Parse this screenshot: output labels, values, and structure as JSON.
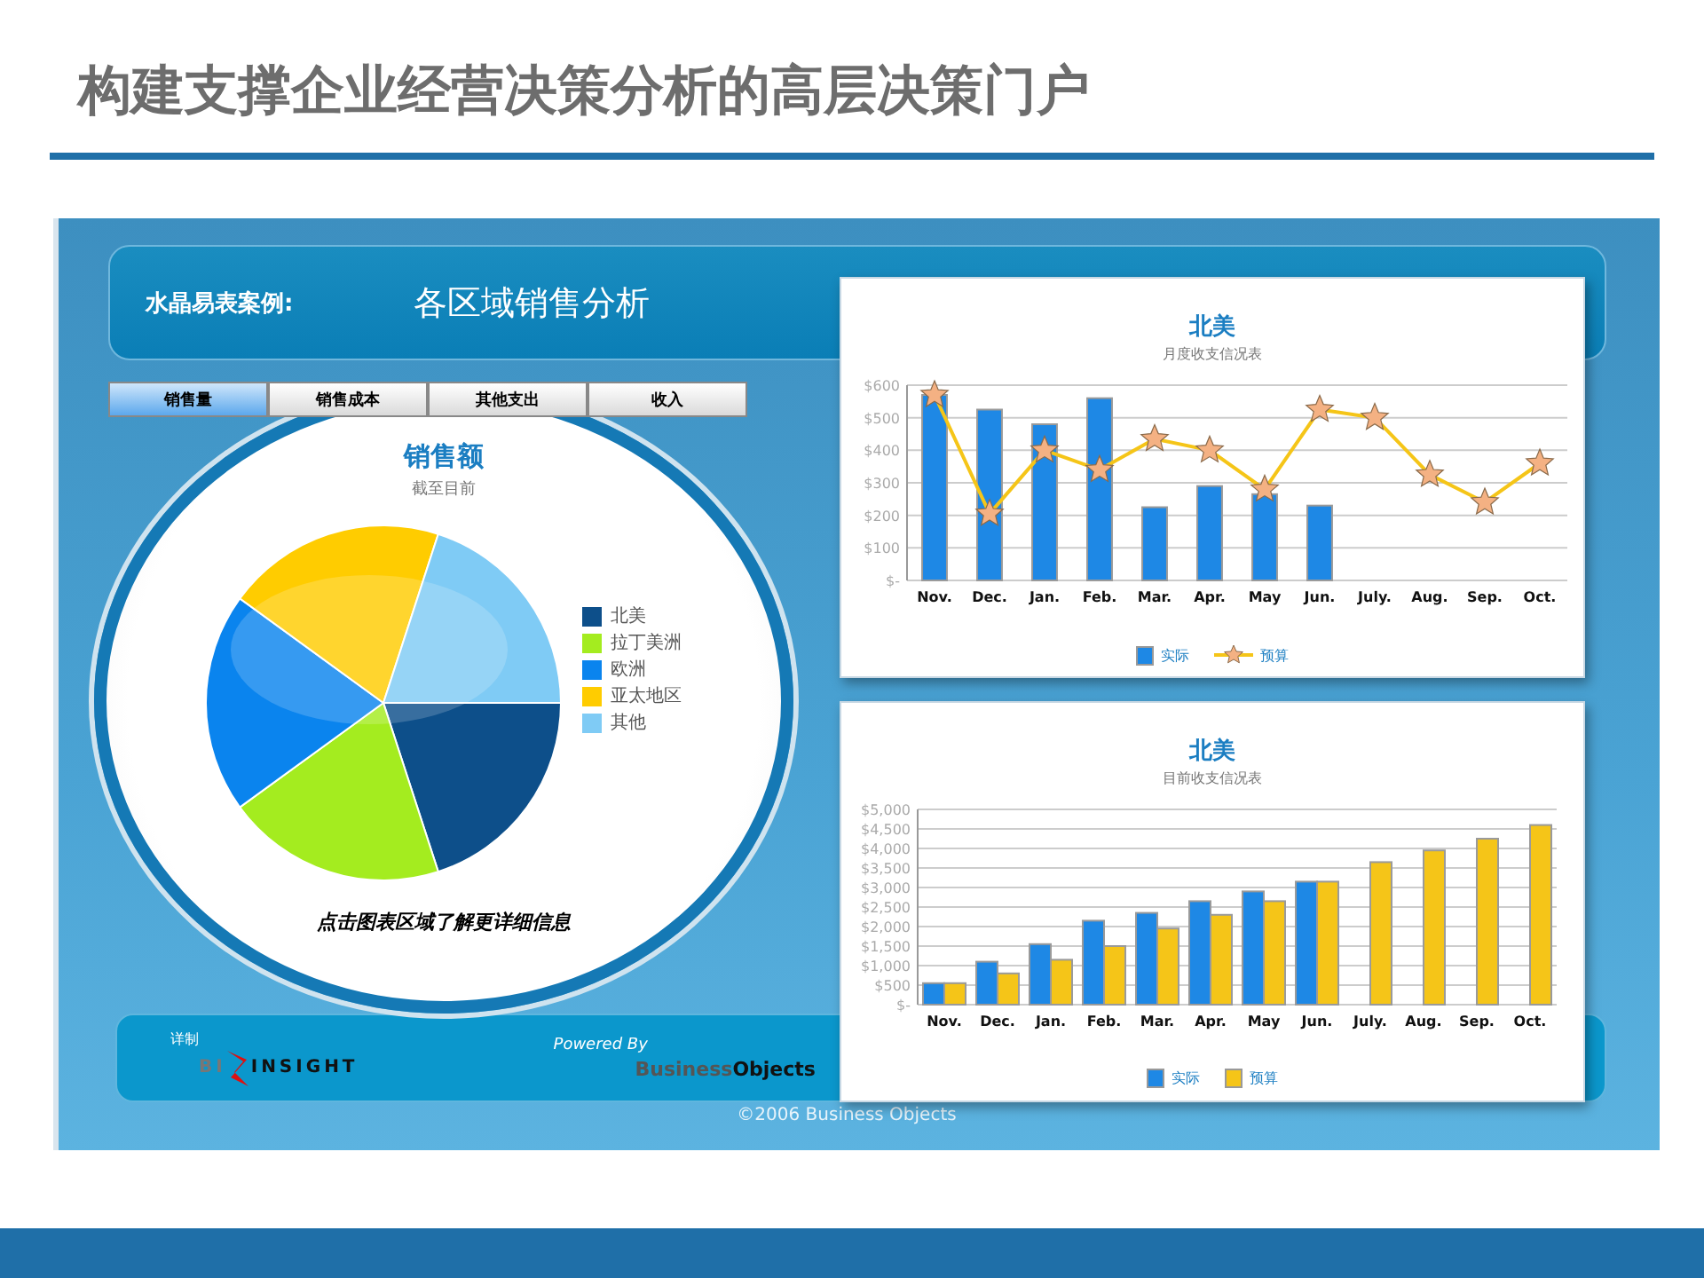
{
  "slide_title": "构建支撑企业经营决策分析的高层决策门户",
  "dashboard": {
    "label": "水晶易表案例:",
    "title": "各区域销售分析",
    "tabs": [
      {
        "label": "销售量",
        "selected": true
      },
      {
        "label": "销售成本",
        "selected": false
      },
      {
        "label": "其他支出",
        "selected": false
      },
      {
        "label": "收入",
        "selected": false
      }
    ],
    "pie_panel": {
      "title": "销售额",
      "subtitle": "截至目前",
      "legend": [
        {
          "label": "北美",
          "color": "#0d4f8a"
        },
        {
          "label": "拉丁美洲",
          "color": "#a4ec1f"
        },
        {
          "label": "欧洲",
          "color": "#0a84ee"
        },
        {
          "label": "亚太地区",
          "color": "#ffcc00"
        },
        {
          "label": "其他",
          "color": "#7fcbf5"
        }
      ],
      "hint": "点击图表区域了解更详细信息"
    },
    "charts": [
      {
        "subtitle": "月度收支信况表",
        "chart_data": {
          "type": "bar",
          "title": "北美",
          "categories": [
            "Nov.",
            "Dec.",
            "Jan.",
            "Feb.",
            "Mar.",
            "Apr.",
            "May",
            "Jun.",
            "July.",
            "Aug.",
            "Sep.",
            "Oct."
          ],
          "ylim": [
            0,
            600
          ],
          "grid": true,
          "stacked": false,
          "yticks": [
            {
              "value": 0,
              "label": "$-"
            },
            {
              "value": 100,
              "label": "$100"
            },
            {
              "value": 200,
              "label": "$200"
            },
            {
              "value": 300,
              "label": "$300"
            },
            {
              "value": 400,
              "label": "$400"
            },
            {
              "value": 500,
              "label": "$500"
            },
            {
              "value": 600,
              "label": "$600"
            }
          ],
          "series": [
            {
              "name": "实际",
              "color": "#1e88e5",
              "values": [
                570,
                525,
                480,
                560,
                225,
                290,
                265,
                230,
                null,
                null,
                null,
                null
              ]
            },
            {
              "name": "预算",
              "type": "line",
              "marker": "star",
              "color": "#f5c518",
              "values": [
                570,
                205,
                400,
                340,
                435,
                400,
                280,
                525,
                500,
                325,
                240,
                360
              ]
            }
          ]
        }
      },
      {
        "subtitle": "目前收支信况表",
        "chart_data": {
          "type": "bar",
          "title": "北美",
          "categories": [
            "Nov.",
            "Dec.",
            "Jan.",
            "Feb.",
            "Mar.",
            "Apr.",
            "May",
            "Jun.",
            "July.",
            "Aug.",
            "Sep.",
            "Oct."
          ],
          "ylim": [
            0,
            5000
          ],
          "grid": true,
          "stacked": false,
          "yticks": [
            {
              "value": 0,
              "label": "$-"
            },
            {
              "value": 500,
              "label": "$500"
            },
            {
              "value": 1000,
              "label": "$1,000"
            },
            {
              "value": 1500,
              "label": "$1,500"
            },
            {
              "value": 2000,
              "label": "$2,000"
            },
            {
              "value": 2500,
              "label": "$2,500"
            },
            {
              "value": 3000,
              "label": "$3,000"
            },
            {
              "value": 3500,
              "label": "$3,500"
            },
            {
              "value": 4000,
              "label": "$4,000"
            },
            {
              "value": 4500,
              "label": "$4,500"
            },
            {
              "value": 5000,
              "label": "$5,000"
            }
          ],
          "series": [
            {
              "name": "实际",
              "color": "#1e88e5",
              "values": [
                550,
                1100,
                1550,
                2150,
                2350,
                2650,
                2900,
                3150,
                null,
                null,
                null,
                null
              ]
            },
            {
              "name": "预算",
              "color": "#f5c518",
              "values": [
                550,
                800,
                1150,
                1500,
                1950,
                2300,
                2650,
                3150,
                3650,
                3950,
                4250,
                4600
              ]
            }
          ]
        }
      }
    ],
    "footer": {
      "made_by": "详制",
      "logo_left": "BI",
      "logo_right": "INSIGHT",
      "powered_by": "Powered By",
      "vendor_left": "Business",
      "vendor_right": "Objects"
    },
    "copyright": "©2006 Business Objects"
  }
}
